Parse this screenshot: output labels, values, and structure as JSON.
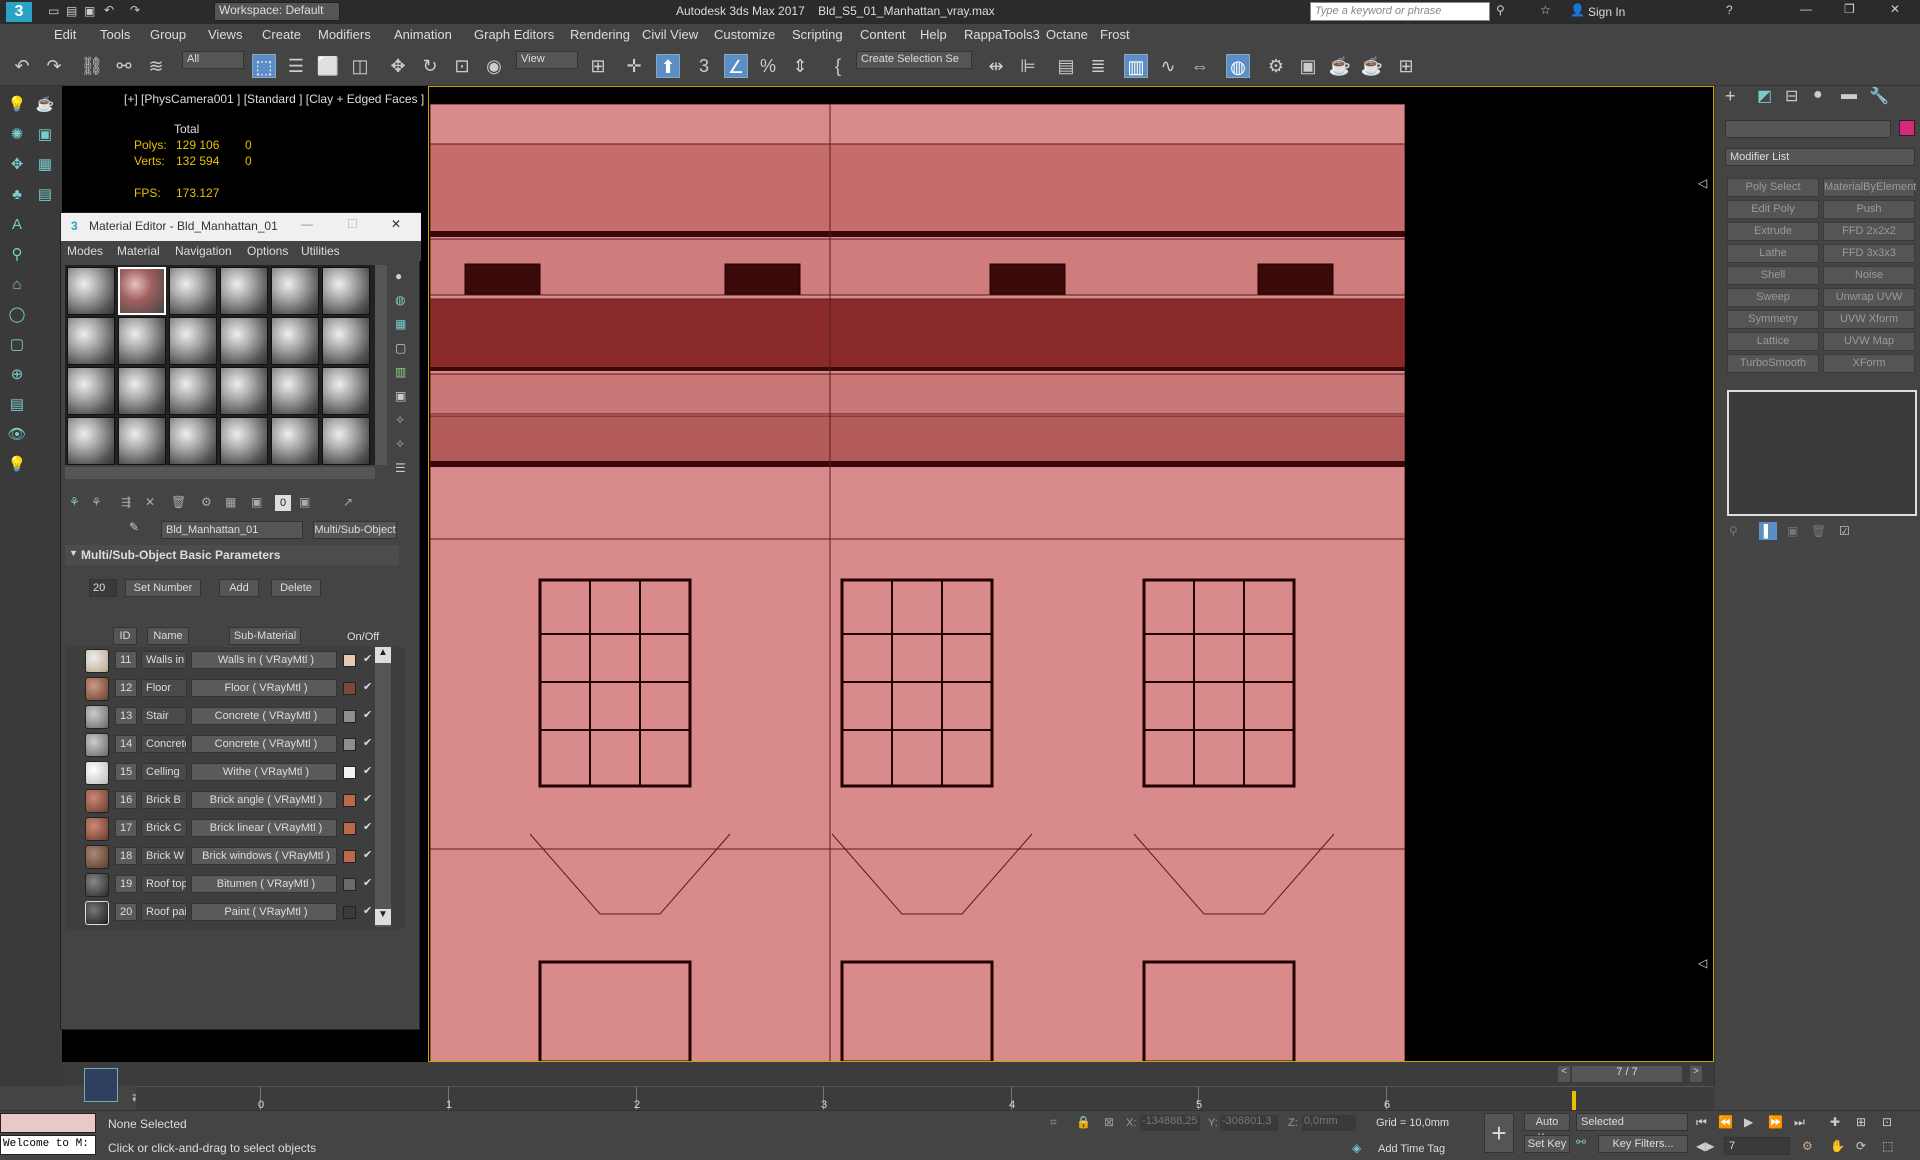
{
  "titlebar": {
    "workspace": "Workspace: Default",
    "title": "Autodesk 3ds Max 2017    Bld_S5_01_Manhattan_vray.max",
    "search_placeholder": "Type a keyword or phrase",
    "signin": "Sign In"
  },
  "menubar": {
    "items": [
      "Edit",
      "Tools",
      "Group",
      "Views",
      "Create",
      "Modifiers",
      "Animation",
      "Graph Editors",
      "Rendering",
      "Civil View",
      "Customize",
      "Scripting",
      "Content",
      "Help",
      "RappaTools3",
      "Octane",
      "Frost"
    ]
  },
  "toolbar": {
    "filter": "All",
    "refcoord": "View",
    "selset": "Create Selection Se"
  },
  "viewport": {
    "label": "[+] [PhysCamera001 ] [Standard ] [Clay + Edged Faces ]",
    "stats_total": "Total",
    "polys_label": "Polys:",
    "polys": "129 106",
    "polys_sel": "0",
    "verts_label": "Verts:",
    "verts": "132 594",
    "verts_sel": "0",
    "fps_label": "FPS:",
    "fps": "173.127"
  },
  "material_editor": {
    "title": "Material Editor - Bld_Manhattan_01",
    "menus": [
      "Modes",
      "Material",
      "Navigation",
      "Options",
      "Utilities"
    ],
    "material_name": "Bld_Manhattan_01",
    "material_type": "Multi/Sub-Object",
    "rollout": "Multi/Sub-Object Basic Parameters",
    "count": "20",
    "set_number": "Set Number",
    "add": "Add",
    "delete": "Delete",
    "col_id": "ID",
    "col_name": "Name",
    "col_sub": "Sub-Material",
    "col_onoff": "On/Off",
    "rows": [
      {
        "id": "11",
        "name": "Walls in",
        "sub": "Walls in  ( VRayMtl )",
        "color": "#e6c9b0",
        "thumb": "#b9a48a"
      },
      {
        "id": "12",
        "name": "Floor",
        "sub": "Floor  ( VRayMtl )",
        "color": "#7a4a38",
        "thumb": "#6a3d2a"
      },
      {
        "id": "13",
        "name": "Stair",
        "sub": "Concrete  ( VRayMtl )",
        "color": "#8e8e8e",
        "thumb": "#777"
      },
      {
        "id": "14",
        "name": "Concrete",
        "sub": "Concrete  ( VRayMtl )",
        "color": "#8e8e8e",
        "thumb": "#777"
      },
      {
        "id": "15",
        "name": "Celling",
        "sub": "Withe  ( VRayMtl )",
        "color": "#f2f2f2",
        "thumb": "#ccc"
      },
      {
        "id": "16",
        "name": "Brick B",
        "sub": "Brick angle  ( VRayMtl )",
        "color": "#b9684a",
        "thumb": "#8a4a33"
      },
      {
        "id": "17",
        "name": "Brick C",
        "sub": "Brick linear  ( VRayMtl )",
        "color": "#b9684a",
        "thumb": "#8a4a33"
      },
      {
        "id": "18",
        "name": "Brick W",
        "sub": "Brick windows  ( VRayMtl )",
        "color": "#b9684a",
        "thumb": "#7a4a3a"
      },
      {
        "id": "19",
        "name": "Roof top",
        "sub": "Bitumen  ( VRayMtl )",
        "color": "#6a6a6a",
        "thumb": "#3a3a3a"
      },
      {
        "id": "20",
        "name": "Roof paint",
        "sub": "Paint  ( VRayMtl )",
        "color": "#3a3a3a",
        "thumb": "#2a2a2a"
      }
    ]
  },
  "command_panel": {
    "modifier_list": "Modifier List",
    "modifiers": [
      "Poly Select",
      "MaterialByElement",
      "Edit Poly",
      "Push",
      "Extrude",
      "FFD 2x2x2",
      "Lathe",
      "FFD 3x3x3",
      "Shell",
      "Noise",
      "Sweep",
      "Unwrap UVW",
      "Symmetry",
      "UVW Xform",
      "Lattice",
      "UVW Map",
      "TurboSmooth",
      "XForm"
    ],
    "accent": "#d6297b"
  },
  "timeline": {
    "frame": "7 / 7",
    "ticks": [
      "0",
      "1",
      "2",
      "3",
      "4",
      "5",
      "6"
    ]
  },
  "status": {
    "maxscript": "Welcome to M:",
    "selection": "None Selected",
    "prompt": "Click or click-and-drag to select objects",
    "x_label": "X:",
    "x": "-134888,25",
    "y_label": "Y:",
    "y": "-306801,3",
    "z_label": "Z:",
    "z": "0,0mm",
    "grid": "Grid = 10,0mm",
    "add_time_tag": "Add Time Tag",
    "autokey": "Auto Key",
    "selected": "Selected",
    "setkey": "Set Key",
    "keyfilters": "Key Filters...",
    "frame_field": "7"
  }
}
